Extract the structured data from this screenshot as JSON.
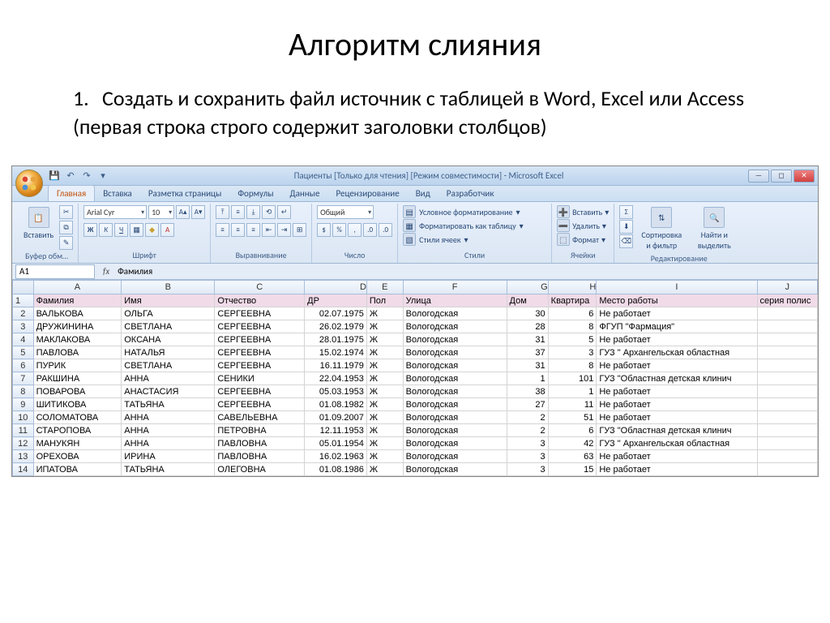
{
  "slide": {
    "title": "Алгоритм слияния",
    "bullet_num": "1.",
    "bullet_text": "Создать и сохранить файл источник  с таблицей в Word, Excel или Access (первая строка строго содержит заголовки столбцов)"
  },
  "titlebar": "Пациенты  [Только для чтения]  [Режим совместимости] - Microsoft Excel",
  "tabs": [
    "Главная",
    "Вставка",
    "Разметка страницы",
    "Формулы",
    "Данные",
    "Рецензирование",
    "Вид",
    "Разработчик"
  ],
  "ribbon": {
    "clipboard": {
      "label": "Буфер обм…",
      "paste": "Вставить"
    },
    "font": {
      "label": "Шрифт",
      "name": "Arial Cyr",
      "size": "10"
    },
    "align": {
      "label": "Выравнивание"
    },
    "number": {
      "label": "Число",
      "format": "Общий"
    },
    "styles": {
      "label": "Стили",
      "condfmt": "Условное форматирование",
      "astable": "Форматировать как таблицу",
      "cellstyle": "Стили ячеек"
    },
    "cells": {
      "label": "Ячейки",
      "insert": "Вставить",
      "delete": "Удалить",
      "format": "Формат"
    },
    "edit": {
      "label": "Редактирование",
      "sort": "Сортировка и фильтр",
      "find": "Найти и выделить"
    }
  },
  "namebox": "A1",
  "formula": "Фамилия",
  "columns": [
    "A",
    "B",
    "C",
    "D",
    "E",
    "F",
    "G",
    "H",
    "I",
    "J"
  ],
  "headers": {
    "A": "Фамилия",
    "B": "Имя",
    "C": "Отчество",
    "D": "ДР",
    "E": "Пол",
    "F": "Улица",
    "G": "Дом",
    "H": "Квартира",
    "I": "Место работы",
    "J": "серия полис"
  },
  "rows": [
    {
      "n": 2,
      "A": "ВАЛЬКОВА",
      "B": "ОЛЬГА",
      "C": "СЕРГЕЕВНА",
      "D": "02.07.1975",
      "E": "Ж",
      "F": "Вологодская",
      "G": "30",
      "H": "6",
      "I": "Не работает"
    },
    {
      "n": 3,
      "A": "ДРУЖИНИНА",
      "B": "СВЕТЛАНА",
      "C": "СЕРГЕЕВНА",
      "D": "26.02.1979",
      "E": "Ж",
      "F": "Вологодская",
      "G": "28",
      "H": "8",
      "I": "ФГУП \"Фармация\""
    },
    {
      "n": 4,
      "A": "МАКЛАКОВА",
      "B": "ОКСАНА",
      "C": "СЕРГЕЕВНА",
      "D": "28.01.1975",
      "E": "Ж",
      "F": "Вологодская",
      "G": "31",
      "H": "5",
      "I": "Не работает"
    },
    {
      "n": 5,
      "A": "ПАВЛОВА",
      "B": "НАТАЛЬЯ",
      "C": "СЕРГЕЕВНА",
      "D": "15.02.1974",
      "E": "Ж",
      "F": "Вологодская",
      "G": "37",
      "H": "3",
      "I": "ГУЗ \" Архангельская областная"
    },
    {
      "n": 6,
      "A": "ПУРИК",
      "B": "СВЕТЛАНА",
      "C": "СЕРГЕЕВНА",
      "D": "16.11.1979",
      "E": "Ж",
      "F": "Вологодская",
      "G": "31",
      "H": "8",
      "I": "Не работает"
    },
    {
      "n": 7,
      "A": "РАКШИНА",
      "B": "АННА",
      "C": "СЕНИКИ",
      "D": "22.04.1953",
      "E": "Ж",
      "F": "Вологодская",
      "G": "1",
      "H": "101",
      "I": "ГУЗ \"Областная детская клинич"
    },
    {
      "n": 8,
      "A": "ПОВАРОВА",
      "B": "АНАСТАСИЯ",
      "C": "СЕРГЕЕВНА",
      "D": "05.03.1953",
      "E": "Ж",
      "F": "Вологодская",
      "G": "38",
      "H": "1",
      "I": "Не работает"
    },
    {
      "n": 9,
      "A": "ШИТИКОВА",
      "B": "ТАТЬЯНА",
      "C": "СЕРГЕЕВНА",
      "D": "01.08.1982",
      "E": "Ж",
      "F": "Вологодская",
      "G": "27",
      "H": "11",
      "I": "Не работает"
    },
    {
      "n": 10,
      "A": "СОЛОМАТОВА",
      "B": "АННА",
      "C": "САВЕЛЬЕВНА",
      "D": "01.09.2007",
      "E": "Ж",
      "F": "Вологодская",
      "G": "2",
      "H": "51",
      "I": "Не работает"
    },
    {
      "n": 11,
      "A": "СТАРОПОВА",
      "B": "АННА",
      "C": "ПЕТРОВНА",
      "D": "12.11.1953",
      "E": "Ж",
      "F": "Вологодская",
      "G": "2",
      "H": "6",
      "I": "ГУЗ \"Областная детская клинич"
    },
    {
      "n": 12,
      "A": "МАНУКЯН",
      "B": "АННА",
      "C": "ПАВЛОВНА",
      "D": "05.01.1954",
      "E": "Ж",
      "F": "Вологодская",
      "G": "3",
      "H": "42",
      "I": "ГУЗ \" Архангельская областная"
    },
    {
      "n": 13,
      "A": "ОРЕХОВА",
      "B": "ИРИНА",
      "C": "ПАВЛОВНА",
      "D": "16.02.1963",
      "E": "Ж",
      "F": "Вологодская",
      "G": "3",
      "H": "63",
      "I": "Не работает"
    },
    {
      "n": 14,
      "A": "ИПАТОВА",
      "B": "ТАТЬЯНА",
      "C": "ОЛЕГОВНА",
      "D": "01.08.1986",
      "E": "Ж",
      "F": "Вологодская",
      "G": "3",
      "H": "15",
      "I": "Не работает"
    }
  ]
}
